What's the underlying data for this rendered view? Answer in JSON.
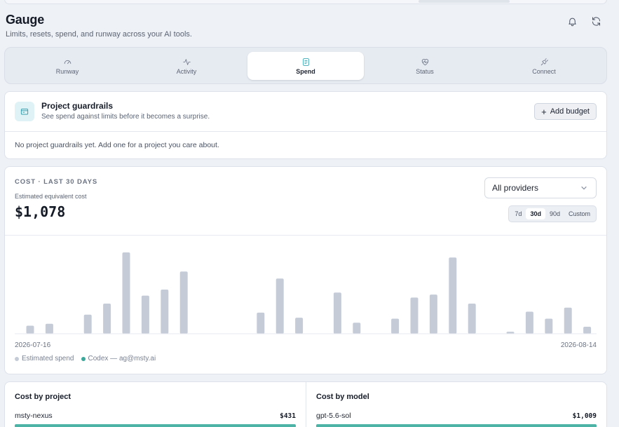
{
  "app": {
    "title": "Gauge",
    "subtitle": "Limits, resets, spend, and runway across your AI tools."
  },
  "header": {
    "notifications_icon": "bell-icon",
    "refresh_icon": "refresh-icon"
  },
  "tabs": [
    {
      "label": "Runway",
      "icon": "gauge-icon",
      "active": false
    },
    {
      "label": "Activity",
      "icon": "pulse-icon",
      "active": false
    },
    {
      "label": "Spend",
      "icon": "receipt-icon",
      "active": true
    },
    {
      "label": "Status",
      "icon": "heart-pulse-icon",
      "active": false
    },
    {
      "label": "Connect",
      "icon": "plug-icon",
      "active": false
    }
  ],
  "guardrails": {
    "title": "Project guardrails",
    "subtitle": "See spend against limits before it becomes a surprise.",
    "add_button": "Add budget",
    "empty_text": "No project guardrails yet. Add one for a project you care about."
  },
  "cost": {
    "kicker": "COST · LAST 30 DAYS",
    "estimate_label": "Estimated equivalent cost",
    "total": "$1,078",
    "provider_select": "All providers",
    "ranges": [
      {
        "label": "7d",
        "active": false
      },
      {
        "label": "30d",
        "active": true
      },
      {
        "label": "90d",
        "active": false
      },
      {
        "label": "Custom",
        "active": false
      }
    ],
    "x_start": "2026-07-16",
    "x_end": "2026-08-14",
    "legend": [
      {
        "label": "Estimated spend",
        "color": "#c5ccd8"
      },
      {
        "label": "Codex — ag@msty.ai",
        "color": "#3aa79a"
      }
    ]
  },
  "chart_data": {
    "type": "bar",
    "title": "",
    "xlabel": "",
    "ylabel": "",
    "x": [
      "2026-07-16",
      "2026-07-17",
      "2026-07-18",
      "2026-07-19",
      "2026-07-20",
      "2026-07-21",
      "2026-07-22",
      "2026-07-23",
      "2026-07-24",
      "2026-07-25",
      "2026-07-26",
      "2026-07-27",
      "2026-07-28",
      "2026-07-29",
      "2026-07-30",
      "2026-07-31",
      "2026-08-01",
      "2026-08-02",
      "2026-08-03",
      "2026-08-04",
      "2026-08-05",
      "2026-08-06",
      "2026-08-07",
      "2026-08-08",
      "2026-08-09",
      "2026-08-10",
      "2026-08-11",
      "2026-08-12",
      "2026-08-13",
      "2026-08-14"
    ],
    "series": [
      {
        "name": "Estimated spend",
        "values": [
          8,
          10,
          0,
          19,
          30,
          81,
          38,
          44,
          62,
          0,
          0,
          0,
          21,
          55,
          16,
          0,
          41,
          11,
          0,
          15,
          36,
          39,
          76,
          30,
          0,
          2,
          22,
          15,
          26,
          7
        ]
      },
      {
        "name": "Codex — ag@msty.ai",
        "values": [
          0,
          0,
          0,
          0,
          0,
          0,
          0,
          0,
          0,
          0,
          0,
          0,
          0,
          0,
          0,
          0,
          0,
          0,
          0,
          0,
          0,
          0,
          0,
          0,
          0,
          0,
          0,
          0,
          0,
          0
        ]
      }
    ],
    "grid": false,
    "legend": "bottom-left"
  },
  "by_project": {
    "title": "Cost by project",
    "top_name": "msty-nexus",
    "top_value": "$431",
    "top_share": 1.0
  },
  "by_model": {
    "title": "Cost by model",
    "top_name": "gpt-5.6-sol",
    "top_value": "$1,009",
    "top_share": 1.0
  }
}
